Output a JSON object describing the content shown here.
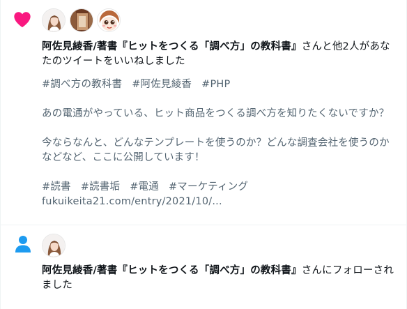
{
  "colors": {
    "like": "#f91880",
    "follow": "#1d9bf0",
    "secondary_text": "#536471",
    "primary_text": "#0f1419"
  },
  "like_notification": {
    "type_icon": "heart-icon",
    "actor_name": "阿佐見綾香/著書『ヒットをつくる「調べ方」の教科書』",
    "action_text": "さんと他2人があなたのツイートをいいねしました",
    "tweet": {
      "hashtags_top": [
        "#調べ方の教科書",
        "#阿佐見綾香",
        "#PHP"
      ],
      "para1": "あの電通がやっている、ヒット商品をつくる調べ方を知りたくないですか？",
      "para2": "今ならなんと、どんなテンプレートを使うのか？どんな調査会社を使うのかなどなど、ここに公開しています！",
      "hashtags_bottom": [
        "#読書",
        "#読書垢",
        "#電通",
        "#マーケティング"
      ],
      "link": "fukuikeita21.com/entry/2021/10/..."
    }
  },
  "follow_notification": {
    "type_icon": "person-icon",
    "actor_name": "阿佐見綾香/著書『ヒットをつくる「調べ方」の教科書』",
    "action_text": "さんにフォローされました"
  }
}
